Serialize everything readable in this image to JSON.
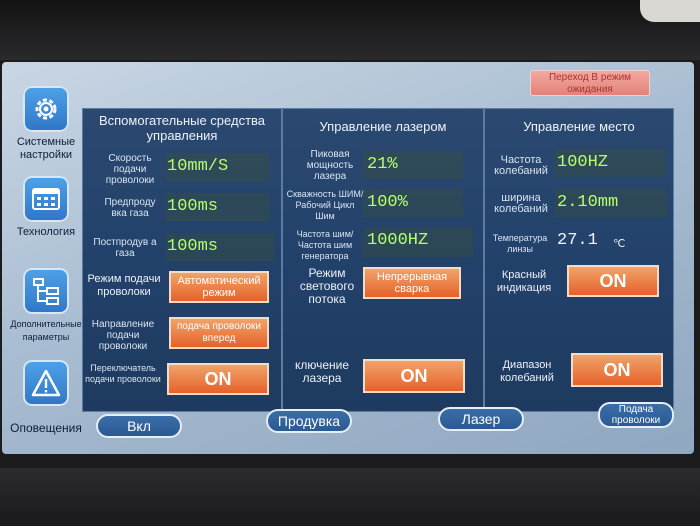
{
  "notification": "Переход В режим ожидания",
  "sidebar": {
    "items": [
      {
        "label": "Системные настройки",
        "icon": "gear-icon"
      },
      {
        "label": "Технология",
        "icon": "grid-icon"
      },
      {
        "label": "Дополнительные параметры",
        "icon": "tree-icon"
      },
      {
        "label": "Оповещения",
        "icon": "warning-icon"
      }
    ]
  },
  "aux": {
    "title": "Вспомогательные средства управления",
    "wire_speed_label": "Скорость подачи проволоки",
    "wire_speed_value": "10mm/S",
    "pre_gas_label": "Предпроду вка газа",
    "pre_gas_value": "100ms",
    "post_gas_label": "Постпродув а газа",
    "post_gas_value": "100ms",
    "feed_mode_label": "Режим подачи проволоки",
    "feed_mode_button": "Автоматический режим",
    "feed_dir_label": "Направление подачи проволоки",
    "feed_dir_button": "подача проволоки вперед",
    "feed_switch_label": "Переключатель подачи проволоки",
    "feed_switch_button": "ON"
  },
  "laser": {
    "title": "Управление лазером",
    "peak_power_label": "Пиковая мощность лазера",
    "peak_power_value": "21%",
    "duty_label": "Скважность ШИМ/Рабочий Цикл Шим",
    "duty_value": "100%",
    "freq_label": "Частота шим/ Частота шим генератора",
    "freq_value": "1000HZ",
    "mode_label": "Режим светового потока",
    "mode_button": "Непрерывная сварка",
    "enable_label": "ключение лазера",
    "enable_button": "ON"
  },
  "place": {
    "title": "Управление место",
    "osc_freq_label": "Частота колебаний",
    "osc_freq_value": "100HZ",
    "osc_width_label": "ширина колебаний",
    "osc_width_value": "2.10mm",
    "lens_temp_label": "Температура линзы",
    "lens_temp_value": "27.1",
    "lens_temp_unit": "℃",
    "red_label": "Красный индикация",
    "red_button": "ON",
    "range_label": "Диапазон колебаний",
    "range_button": "ON"
  },
  "bottom": {
    "on": "Вкл",
    "purge": "Продувка",
    "laser": "Лазер",
    "feed": "Подача проволоки"
  },
  "colors": {
    "value_green": "#b4ff6a",
    "button_orange": "#e5622a",
    "panel_blue": "#22416a"
  }
}
